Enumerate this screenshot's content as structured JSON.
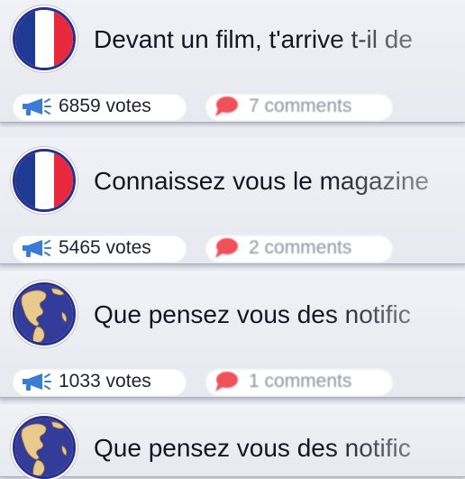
{
  "colors": {
    "background": "#e6e8ef",
    "title_text": "#151522",
    "vote_icon": "#3a7bd5",
    "comment_icon": "#f0505a",
    "comment_text": "#8e929c",
    "avatar_border": "#29318f",
    "flag_blue": "#1f3a93",
    "flag_white": "#ffffff",
    "flag_red": "#e8283c",
    "globe_ocean": "#343c9a",
    "globe_land": "#e9c98c"
  },
  "questions": [
    {
      "title": "Devant un film, t'arrive t-il de",
      "avatar_icon": "france-flag-icon",
      "votes_label": "6859 votes",
      "comments_label": "7 comments"
    },
    {
      "title": "Connaissez vous le magazine",
      "avatar_icon": "france-flag-icon",
      "votes_label": "5465 votes",
      "comments_label": "2 comments"
    },
    {
      "title": "Que pensez vous des notific",
      "avatar_icon": "globe-icon",
      "votes_label": "1033 votes",
      "comments_label": "1 comments"
    },
    {
      "title": "Que pensez vous des notific",
      "avatar_icon": "globe-icon"
    }
  ]
}
